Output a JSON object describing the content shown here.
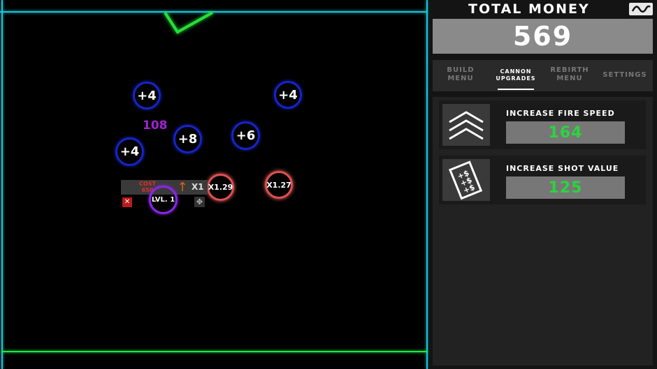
{
  "playfield": {
    "bumpers": [
      {
        "label": "+4"
      },
      {
        "label": "+4"
      },
      {
        "label": "+8"
      },
      {
        "label": "+6"
      },
      {
        "label": "+4"
      },
      {
        "label": "X1.29"
      },
      {
        "label": "X1.27"
      }
    ],
    "floating_value": "108",
    "cannon": {
      "cost_label": "COST\n650",
      "level_label": "LVL. 1",
      "multiplier_label": "X1"
    }
  },
  "sidebar": {
    "title": "TOTAL MONEY",
    "money": "569",
    "tabs": [
      {
        "label": "BUILD\nMENU"
      },
      {
        "label": "CANNON\nUPGRADES"
      },
      {
        "label": "REBIRTH\nMENU"
      },
      {
        "label": "SETTINGS"
      }
    ],
    "upgrades": [
      {
        "name": "INCREASE FIRE SPEED",
        "cost": "164"
      },
      {
        "name": "INCREASE SHOT VALUE",
        "cost": "125"
      }
    ]
  },
  "colors": {
    "cyan_border": "#19c6d8",
    "green_floor": "#1ee84a",
    "bumper_blue": "#1624c8",
    "multiplier_red": "#e05050",
    "cannon_purple": "#8a26e6",
    "cost_green": "#2bd43d"
  }
}
